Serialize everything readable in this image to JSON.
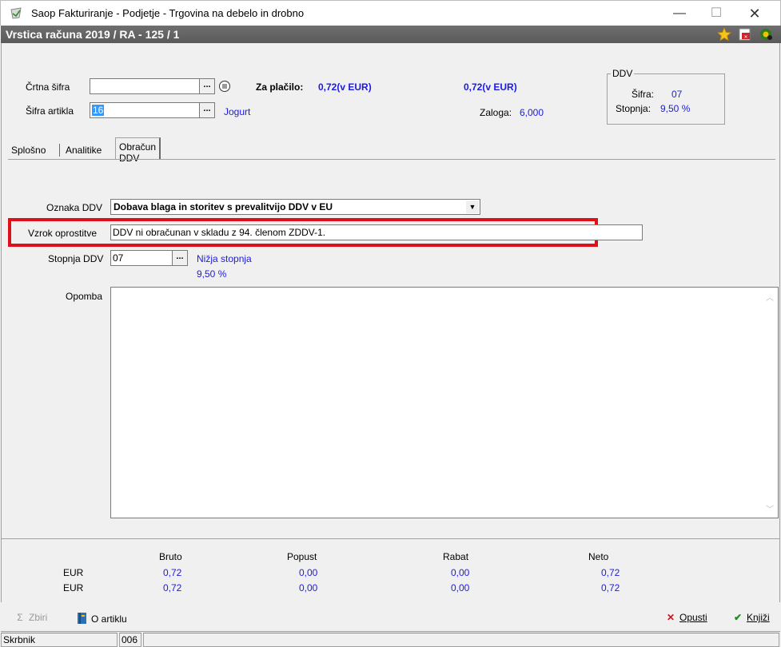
{
  "window": {
    "title": "Saop Fakturiranje - Podjetje - Trgovina na debelo in drobno",
    "minimize": "—",
    "maximize": "☐",
    "close": "✕"
  },
  "header": {
    "title": "Vrstica računa  2019 / RA - 125 / 1"
  },
  "top": {
    "crtna_sifra_label": "Črtna šifra",
    "crtna_sifra_value": "",
    "sifra_artikla_label": "Šifra artikla",
    "sifra_artikla_value": "16",
    "artikel_name": "Jogurt",
    "za_placilo_label": "Za plačilo:",
    "za_placilo_value": "0,72(v EUR)",
    "second_amount": "0,72(v EUR)",
    "zaloga_label": "Zaloga:",
    "zaloga_value": "6,000",
    "dots": "..."
  },
  "ddv": {
    "legend": "DDV",
    "sifra_label": "Šifra:",
    "sifra_value": "07",
    "stopnja_label": "Stopnja:",
    "stopnja_value": "9,50 %"
  },
  "tabs": [
    {
      "label": "Splošno"
    },
    {
      "label": "Analitike"
    },
    {
      "label": "Obračun DDV"
    }
  ],
  "form": {
    "oznaka_ddv_label": "Oznaka DDV",
    "oznaka_ddv_value": "Dobava blaga in storitev s prevalitvijo DDV v EU",
    "vzrok_label": "Vzrok oprostitve",
    "vzrok_value": "DDV ni obračunan v skladu z 94. členom ZDDV-1.",
    "stopnja_label": "Stopnja DDV",
    "stopnja_value": "07",
    "stopnja_name": "Nižja stopnja",
    "stopnja_percent": "9,50 %",
    "opomba_label": "Opomba",
    "opomba_value": ""
  },
  "totals": {
    "headers": [
      "Bruto",
      "Popust",
      "Rabat",
      "Neto"
    ],
    "rows": [
      {
        "currency": "EUR",
        "values": [
          "0,72",
          "0,00",
          "0,00",
          "0,72"
        ]
      },
      {
        "currency": "EUR",
        "values": [
          "0,72",
          "0,00",
          "0,00",
          "0,72"
        ]
      }
    ]
  },
  "actions": {
    "zbiri": "Zbiri",
    "o_artiklu": "O artiklu",
    "opusti": "Opusti",
    "knjizi": "Knjiži"
  },
  "status": {
    "user": "Skrbnik",
    "code": "006"
  },
  "colors": {
    "highlight": "#e0101a",
    "value_blue": "#1a1ae6",
    "header_bg": "#5f5f5f"
  }
}
